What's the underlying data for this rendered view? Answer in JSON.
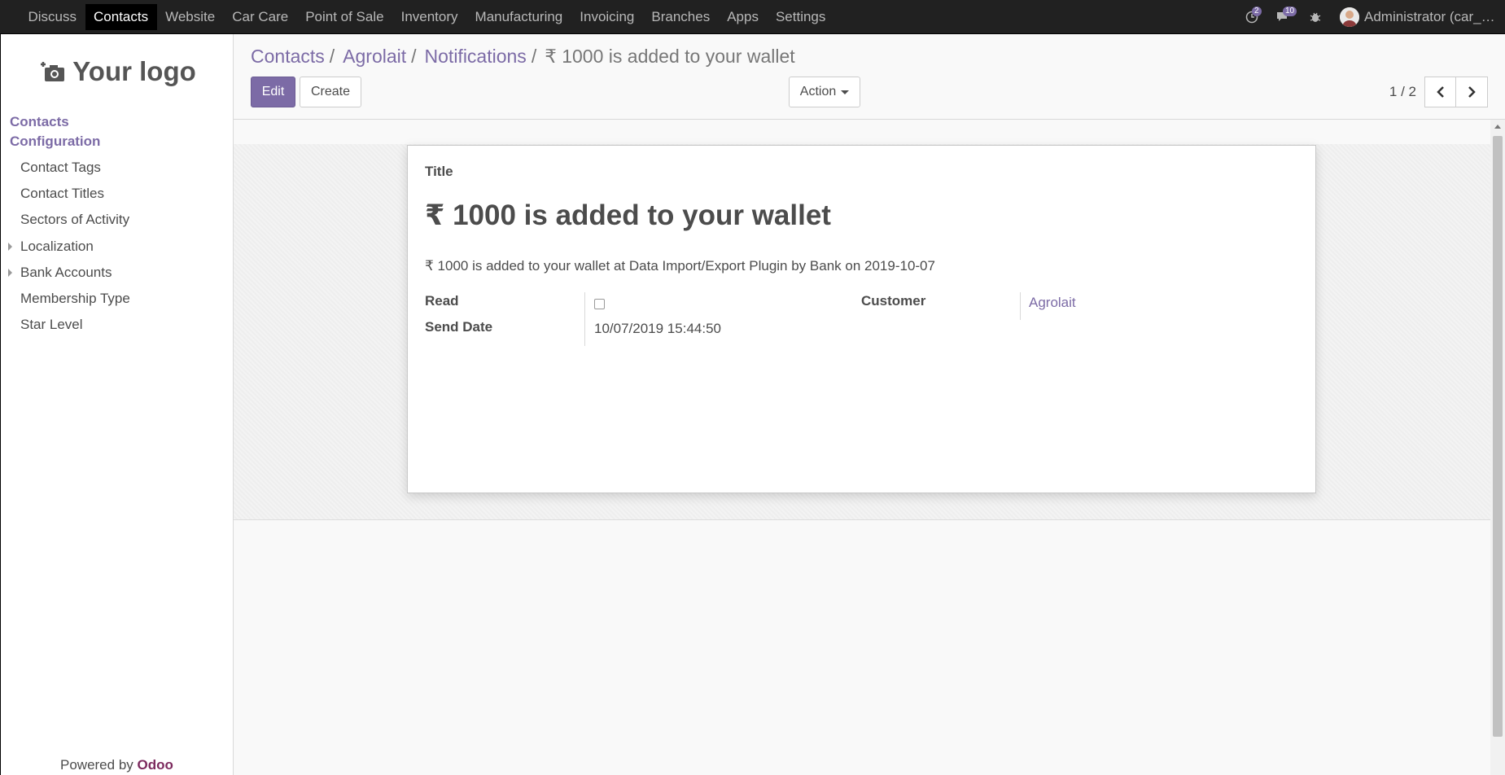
{
  "topbar": {
    "menu": [
      "Discuss",
      "Contacts",
      "Website",
      "Car Care",
      "Point of Sale",
      "Inventory",
      "Manufacturing",
      "Invoicing",
      "Branches",
      "Apps",
      "Settings"
    ],
    "active": "Contacts",
    "activity_count": "2",
    "messages_count": "10",
    "user_name": "Administrator (car_care_demo)"
  },
  "sidebar": {
    "logo_text": "Your logo",
    "heading_contacts": "Contacts",
    "heading_configuration": "Configuration",
    "items": [
      "Contact Tags",
      "Contact Titles",
      "Sectors of Activity",
      "Localization",
      "Bank Accounts",
      "Membership Type",
      "Star Level"
    ],
    "powered_prefix": "Powered by",
    "powered_brand": "Odoo"
  },
  "control": {
    "breadcrumbs": [
      "Contacts",
      "Agrolait",
      "Notifications"
    ],
    "current": "₹ 1000 is added to your wallet",
    "edit_label": "Edit",
    "create_label": "Create",
    "action_label": "Action",
    "pager": "1 / 2"
  },
  "form": {
    "title_label": "Title",
    "title_value": "₹ 1000 is added to your wallet",
    "message": "₹ 1000 is added to your wallet at Data Import/Export Plugin by Bank on 2019-10-07",
    "read_label": "Read",
    "read_checked": false,
    "send_date_label": "Send Date",
    "send_date_value": "10/07/2019 15:44:50",
    "customer_label": "Customer",
    "customer_value": "Agrolait"
  },
  "colors": {
    "brand": "#7c6ba6",
    "navbar": "#212121"
  }
}
